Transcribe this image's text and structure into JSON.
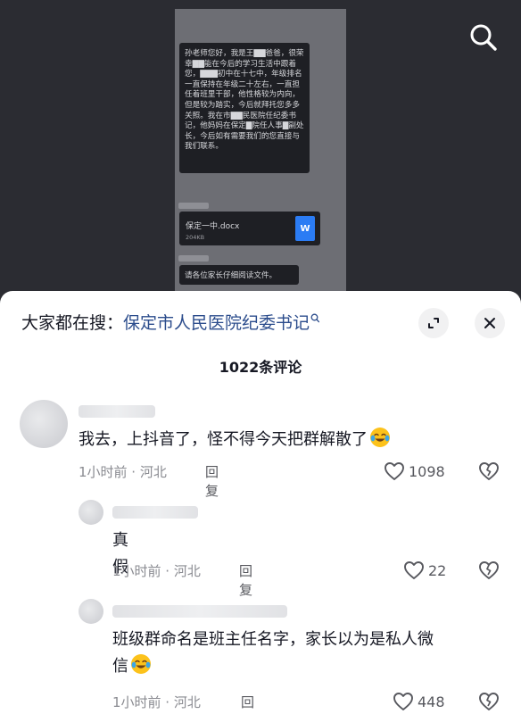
{
  "video": {
    "screenshot_message": "孙老师您好，我是王▇▇爸爸，很荣幸▇▇能在今后的学习生活中跟着您，▇▇▇初中在十七中，年级排名一直保持在年级二十左右，一直担任着班里干部，他性格较为内向，但是较为踏实，今后就拜托您多多关照。我在市▇▇民医院任纪委书记，他妈妈在保定▇院任人事▇副处长，今后如有需要我们的您直接与我们联系。",
    "file_name": "保定一中.docx",
    "file_size": "204KB",
    "file_badge": "W",
    "notice_message": "请各位家长仔细阅读文件。",
    "search_icon": "search-icon"
  },
  "panel": {
    "search_prefix": "大家都在搜：",
    "search_query": "保定市人民医院纪委书记",
    "comment_count": "1022条评论",
    "expand_icon": "expand-icon",
    "close_icon": "close-icon"
  },
  "comments": [
    {
      "text": "我去，上抖音了，怪不得今天把群解散了",
      "emoji": "crying-laughing-emoji",
      "meta": "1小时前 · 河北",
      "reply_label": "回复",
      "likes": "1098"
    },
    {
      "text": "真假",
      "meta": "1小时前 · 河北",
      "reply_label": "回复",
      "likes": "22"
    },
    {
      "text_line1": "班级群命名是班主任名字，家长以为是私人微",
      "text_line2": "信",
      "emoji": "crying-laughing-emoji",
      "meta": "1小时前 · 河北",
      "reply_label": "回复",
      "likes": "448"
    }
  ],
  "colors": {
    "query_link": "#2b4c8c",
    "meta_gray": "#8a8b91",
    "word_blue": "#2b7cf4"
  }
}
